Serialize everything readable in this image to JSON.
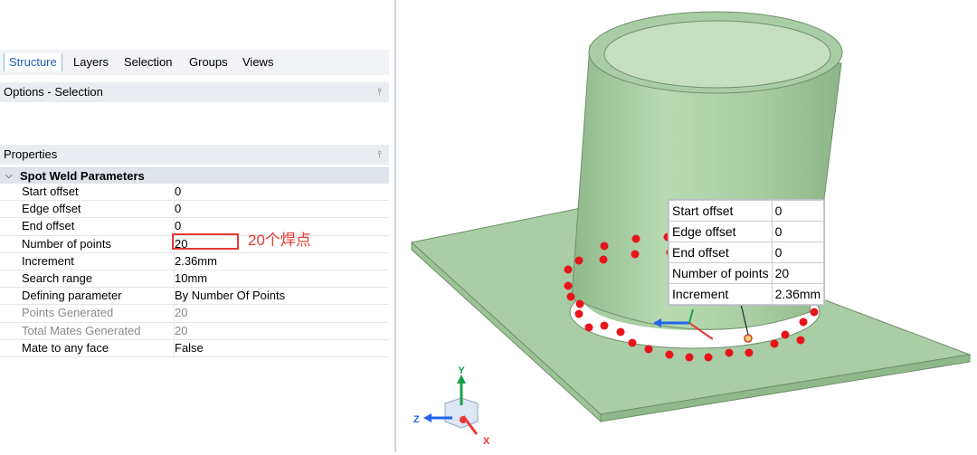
{
  "tabs": [
    "Structure",
    "Layers",
    "Selection",
    "Groups",
    "Views"
  ],
  "options_panel": {
    "title": "Options - Selection",
    "pin_icon": "pin-icon"
  },
  "properties_panel": {
    "title": "Properties",
    "group": {
      "title": "Spot Weld Parameters",
      "expanded": true
    },
    "rows": [
      {
        "key": "Start offset",
        "value": "0",
        "disabled": false
      },
      {
        "key": "Edge offset",
        "value": "0",
        "disabled": false
      },
      {
        "key": "End offset",
        "value": "0",
        "disabled": false
      },
      {
        "key": "Number of points",
        "value": "20",
        "disabled": false
      },
      {
        "key": "Increment",
        "value": "2.36mm",
        "disabled": false
      },
      {
        "key": "Search range",
        "value": "10mm",
        "disabled": false
      },
      {
        "key": "Defining parameter",
        "value": "By Number Of Points",
        "disabled": false
      },
      {
        "key": "Points Generated",
        "value": "20",
        "disabled": true
      },
      {
        "key": "Total Mates Generated",
        "value": "20",
        "disabled": true
      },
      {
        "key": "Mate to any face",
        "value": "False",
        "disabled": false
      }
    ]
  },
  "annotation": {
    "text": "20个焊点",
    "color": "#e53935"
  },
  "callout": {
    "rows": [
      {
        "key": "Start offset",
        "value": "0"
      },
      {
        "key": "Edge offset",
        "value": "0"
      },
      {
        "key": "End offset",
        "value": "0"
      },
      {
        "key": "Number of points",
        "value": "20"
      },
      {
        "key": "Increment",
        "value": "2.36mm"
      }
    ]
  },
  "triad": {
    "y_label": "Y",
    "z_label": "Z",
    "x_label": "X"
  },
  "colors": {
    "model": "#a9cda4",
    "weld_point": "#e8141b",
    "accent": "#1f5fb2",
    "axis_x": "#e53935",
    "axis_y": "#16a34a",
    "axis_z": "#2563eb"
  }
}
